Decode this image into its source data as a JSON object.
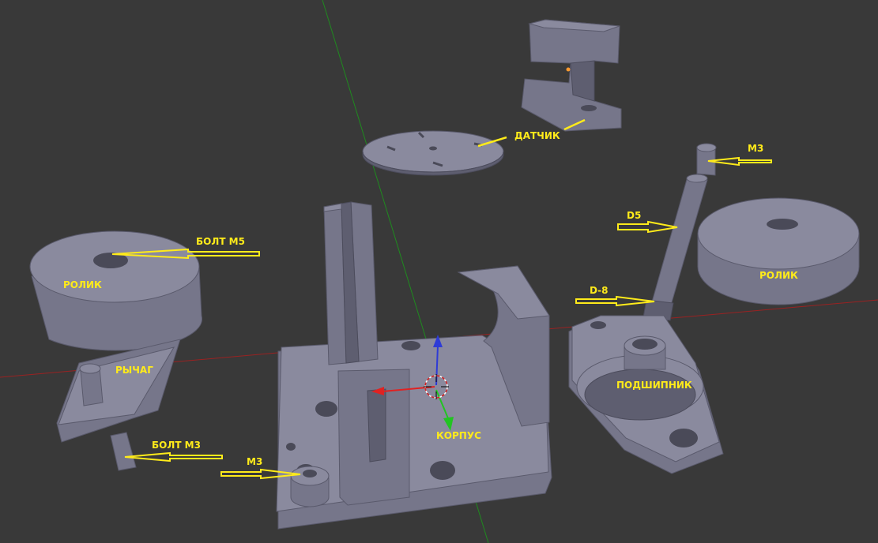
{
  "viewport": {
    "background": "#393939",
    "object_color": "#76768a",
    "selection_color": "#ff9a2e",
    "annotation_color": "#ffeb1a",
    "x_axis_color": "#9a2222",
    "y_axis_color": "#1f8a1f"
  },
  "labels": {
    "datchik": "ДАТЧИК",
    "m3_top": "M3",
    "d5": "D5",
    "bolt_m5": "БОЛТ M5",
    "rolik_left": "РОЛИК",
    "rolik_right": "РОЛИК",
    "d8": "D-8",
    "rychag": "РЫЧАГ",
    "podshipnik": "ПОДШИПНИК",
    "korpus": "КОРПУС",
    "bolt_m3": "БОЛТ M3",
    "m3_bottom": "M3"
  },
  "gizmo": {
    "z": "z-axis-arrow",
    "x": "x-axis-arrow",
    "y": "y-axis-arrow"
  }
}
